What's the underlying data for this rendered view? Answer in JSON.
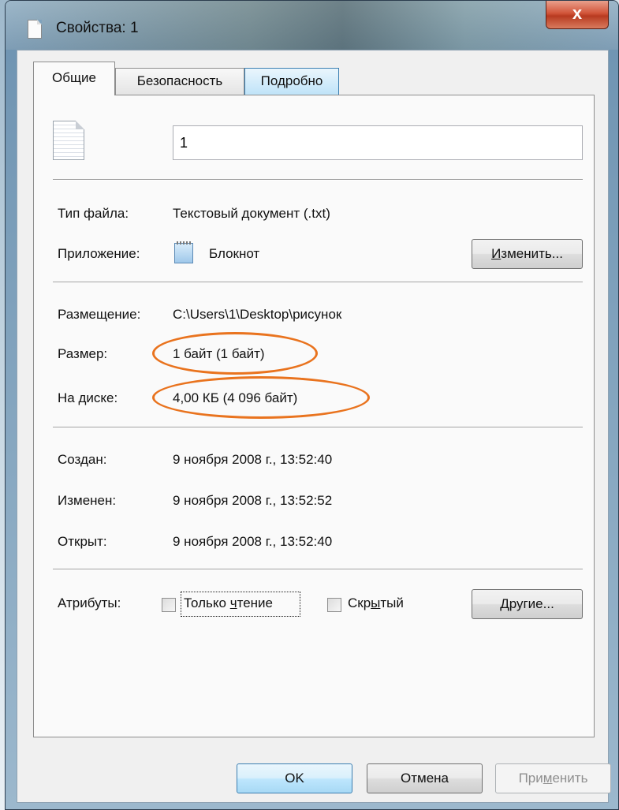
{
  "window": {
    "title": "Свойства: 1",
    "close_label": "x"
  },
  "tabs": [
    {
      "label": "Общие",
      "active": true
    },
    {
      "label": "Безопасность",
      "active": false
    },
    {
      "label": "Подробно",
      "active": false
    }
  ],
  "general": {
    "file_name": "1",
    "file_type_label": "Тип файла:",
    "file_type_value": "Текстовый документ (.txt)",
    "app_label": "Приложение:",
    "app_value": "Блокнот",
    "change_button": {
      "pre": "",
      "u": "И",
      "post": "зменить..."
    },
    "location_label": "Размещение:",
    "location_value": "C:\\Users\\1\\Desktop\\рисунок",
    "size_label": "Размер:",
    "size_value": "1 байт (1 байт)",
    "disk_label": "На диске:",
    "disk_value": "4,00 КБ (4 096 байт)",
    "created_label": "Создан:",
    "created_value": "9 ноября 2008 г., 13:52:40",
    "modified_label": "Изменен:",
    "modified_value": "9 ноября 2008 г., 13:52:52",
    "accessed_label": "Открыт:",
    "accessed_value": "9 ноября 2008 г., 13:52:40",
    "attributes_label": "Атрибуты:",
    "readonly": {
      "pre": "Только ",
      "u": "ч",
      "post": "тение",
      "checked": false
    },
    "hidden": {
      "pre": "Скр",
      "u": "ы",
      "post": "тый",
      "checked": false
    },
    "other_button": {
      "pre": "",
      "u": "Д",
      "post": "ругие..."
    }
  },
  "footer": {
    "ok_label": "OK",
    "cancel_label": "Отмена",
    "apply": {
      "pre": "При",
      "u": "м",
      "post": "енить",
      "enabled": false
    }
  },
  "colors": {
    "highlight_oval": "#e9731e",
    "tab_hover_border": "#3c7fb1"
  }
}
